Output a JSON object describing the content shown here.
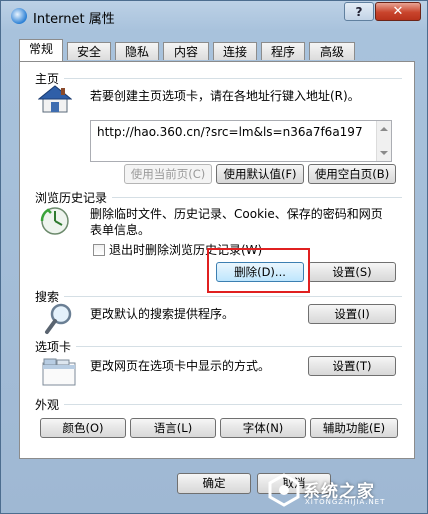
{
  "window": {
    "title": "Internet 属性",
    "help_label": "?",
    "close_label": "✕"
  },
  "tabs": [
    {
      "label": "常规",
      "active": true
    },
    {
      "label": "安全"
    },
    {
      "label": "隐私"
    },
    {
      "label": "内容"
    },
    {
      "label": "连接"
    },
    {
      "label": "程序"
    },
    {
      "label": "高级"
    }
  ],
  "homepage": {
    "section_title": "主页",
    "description": "若要创建主页选项卡，请在各地址行键入地址(R)。",
    "url": "http://hao.360.cn/?src=lm&ls=n36a7f6a197",
    "btn_current": "使用当前页(C)",
    "btn_default": "使用默认值(F)",
    "btn_blank": "使用空白页(B)",
    "icon": "house-icon"
  },
  "history": {
    "section_title": "浏览历史记录",
    "description_line1": "删除临时文件、历史记录、Cookie、保存的密码和网页",
    "description_line2": "表单信息。",
    "checkbox_label": "退出时删除浏览历史记录(W)",
    "checkbox_checked": false,
    "btn_delete": "删除(D)...",
    "btn_settings": "设置(S)",
    "icon": "history-clock-icon"
  },
  "search": {
    "section_title": "搜索",
    "description": "更改默认的搜索提供程序。",
    "btn_settings": "设置(I)",
    "icon": "magnifier-icon"
  },
  "tabs_section": {
    "section_title": "选项卡",
    "description": "更改网页在选项卡中显示的方式。",
    "btn_settings": "设置(T)",
    "icon": "tabbed-window-icon"
  },
  "appearance": {
    "section_title": "外观",
    "btn_colors": "颜色(O)",
    "btn_languages": "语言(L)",
    "btn_fonts": "字体(N)",
    "btn_accessibility": "辅助功能(E)"
  },
  "footer": {
    "ok_label": "确定",
    "cancel_label": "取消"
  },
  "watermark": {
    "text": "系统之家",
    "subtext": "XITONGZHIJIA.NET"
  },
  "colors": {
    "highlight": "#e02020",
    "title_bar": "#a8c2dc",
    "close_button": "#c9442c"
  }
}
